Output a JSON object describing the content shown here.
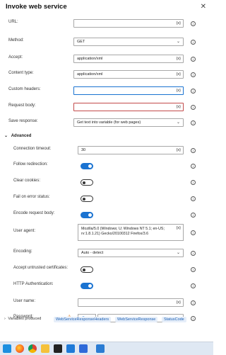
{
  "dialog": {
    "title": "Invoke web service",
    "close": "✕"
  },
  "fields": {
    "url": {
      "label": "URL:",
      "value": ""
    },
    "method": {
      "label": "Method:",
      "value": "GET"
    },
    "accept": {
      "label": "Accept:",
      "value": "application/xml"
    },
    "content_type": {
      "label": "Content type:",
      "value": "application/xml"
    },
    "custom_headers": {
      "label": "Custom headers:",
      "value": ""
    },
    "request_body": {
      "label": "Request body:",
      "value": ""
    },
    "save_response": {
      "label": "Save response:",
      "value": "Get text into variable (for web pages)"
    }
  },
  "advanced": {
    "header": "Advanced",
    "connection_timeout": {
      "label": "Connection timeout:",
      "value": "30"
    },
    "follow_redirection": {
      "label": "Follow redirection:",
      "on": true
    },
    "clear_cookies": {
      "label": "Clear cookies:",
      "on": false
    },
    "fail_on_error": {
      "label": "Fail on error status:",
      "on": false
    },
    "encode_request_body": {
      "label": "Encode request body:",
      "on": true
    },
    "user_agent": {
      "label": "User agent:",
      "value": "Mozilla/5.0 (Windows; U; Windows NT 5.1; en-US; rv:1.8.1.21) Gecko/20100312 Firefox/3.6"
    },
    "encoding": {
      "label": "Encoding:",
      "value": "Auto - detect"
    },
    "accept_untrusted": {
      "label": "Accept untrusted certificates:",
      "on": false
    },
    "http_auth": {
      "label": "HTTP Authentication:",
      "on": true
    },
    "user_name": {
      "label": "User name:",
      "value": ""
    },
    "password": {
      "label": "Password:",
      "value": ""
    }
  },
  "variables": {
    "label": "Variables produced",
    "items": [
      "WebServiceResponseHeaders",
      "WebServiceResponse",
      "StatusCode"
    ]
  },
  "symbols": {
    "var": "{x}",
    "info": "i",
    "chevron": "⌄",
    "expand": "⌄",
    "collapse": "›",
    "warn": "⚠"
  },
  "colors": {
    "accent": "#1a73d1",
    "error": "#c34b4b",
    "warning": "#e07a1f"
  }
}
